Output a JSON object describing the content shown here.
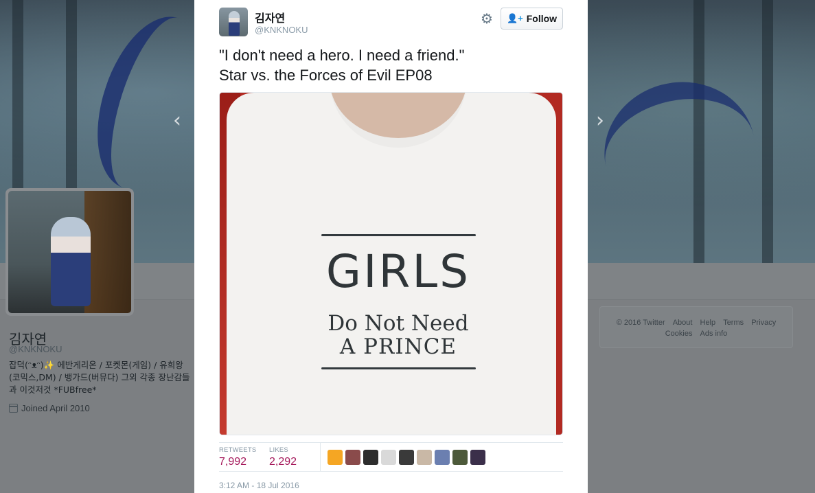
{
  "profile": {
    "name": "김자연",
    "handle": "@KNKNOKU",
    "bio": "잡덕(ᵔᴥᵔ)✨ 에반게리온 / 포켓몬(게임) / 유희왕(코믹스,DM) / 뱅가드(버뮤다) 그외 각종 장난감들과 이것저것 *FUBfree*",
    "joined": "Joined April 2010"
  },
  "footer": {
    "links": [
      "© 2016 Twitter",
      "About",
      "Help",
      "Terms",
      "Privacy",
      "Cookies",
      "Ads info"
    ]
  },
  "nav": {
    "prev_icon": "chevron-left-icon",
    "next_icon": "chevron-right-icon",
    "prev": "‹",
    "next": "›"
  },
  "tweet": {
    "author_name": "김자연",
    "author_handle": "@KNKNOKU",
    "follow_label": "Follow",
    "text_line1": "\"I don't need a hero. I need a friend.\"",
    "text_line2": "Star vs. the Forces of Evil EP08",
    "photo": {
      "line1": "GIRLS",
      "line2": "Do Not Need",
      "line3": "A PRINCE"
    },
    "retweets_label": "RETWEETS",
    "retweets": "7,992",
    "likes_label": "LIKES",
    "likes": "2,292",
    "likers_colors": [
      "#f5a623",
      "#8a4b4b",
      "#2d2d2d",
      "#d9d9d9",
      "#3a3a3a",
      "#c9b8a6",
      "#6b7fb0",
      "#4d5a3a",
      "#3b2f4a"
    ],
    "timestamp": "3:12 AM - 18 Jul 2016"
  }
}
